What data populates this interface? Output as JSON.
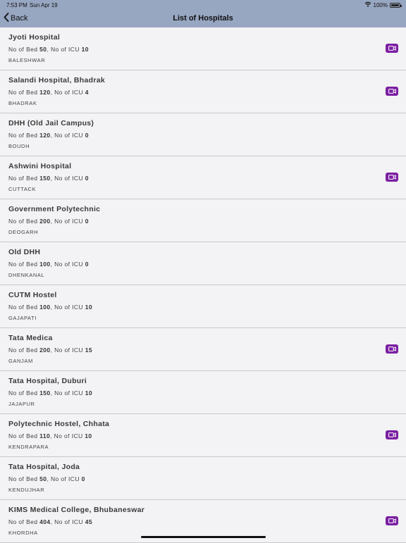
{
  "status_bar": {
    "time": "7:53 PM",
    "date": "Sun Apr 19",
    "battery": "100%"
  },
  "nav": {
    "back_label": "Back",
    "title": "List of Hospitals"
  },
  "labels": {
    "beds_prefix": "No of Bed ",
    "icu_prefix": ", No of ICU "
  },
  "hospitals": [
    {
      "name": "Jyoti Hospital",
      "beds": "50",
      "icu": "10",
      "district": "BALESHWAR",
      "video": true
    },
    {
      "name": "Salandi Hospital, Bhadrak",
      "beds": "120",
      "icu": "4",
      "district": "BHADRAK",
      "video": true
    },
    {
      "name": "DHH (Old Jail Campus)",
      "beds": "120",
      "icu": "0",
      "district": "BOUDH",
      "video": false
    },
    {
      "name": "Ashwini Hospital",
      "beds": "150",
      "icu": "0",
      "district": "CUTTACK",
      "video": true
    },
    {
      "name": "Government Polytechnic",
      "beds": "200",
      "icu": "0",
      "district": "DEOGARH",
      "video": false
    },
    {
      "name": "Old DHH",
      "beds": "100",
      "icu": "0",
      "district": "DHENKANAL",
      "video": false
    },
    {
      "name": "CUTM Hostel",
      "beds": "100",
      "icu": "10",
      "district": "GAJAPATI",
      "video": false
    },
    {
      "name": "Tata Medica",
      "beds": "200",
      "icu": "15",
      "district": "GANJAM",
      "video": true
    },
    {
      "name": "Tata Hospital, Duburi",
      "beds": "150",
      "icu": "10",
      "district": "JAJAPUR",
      "video": false
    },
    {
      "name": "Polytechnic Hostel, Chhata",
      "beds": "110",
      "icu": "10",
      "district": "KENDRAPARA",
      "video": true
    },
    {
      "name": "Tata Hospital, Joda",
      "beds": "50",
      "icu": "0",
      "district": "KENDUJHAR",
      "video": false
    },
    {
      "name": "KIMS Medical College, Bhubaneswar",
      "beds": "404",
      "icu": "45",
      "district": "KHORDHA",
      "video": true
    }
  ],
  "colors": {
    "nav_bg": "#97a6c1",
    "video_button": "#7b1fa2",
    "list_bg": "#f3f3f5"
  },
  "icons": {
    "video": "video-camera-icon",
    "back": "chevron-left-icon"
  }
}
